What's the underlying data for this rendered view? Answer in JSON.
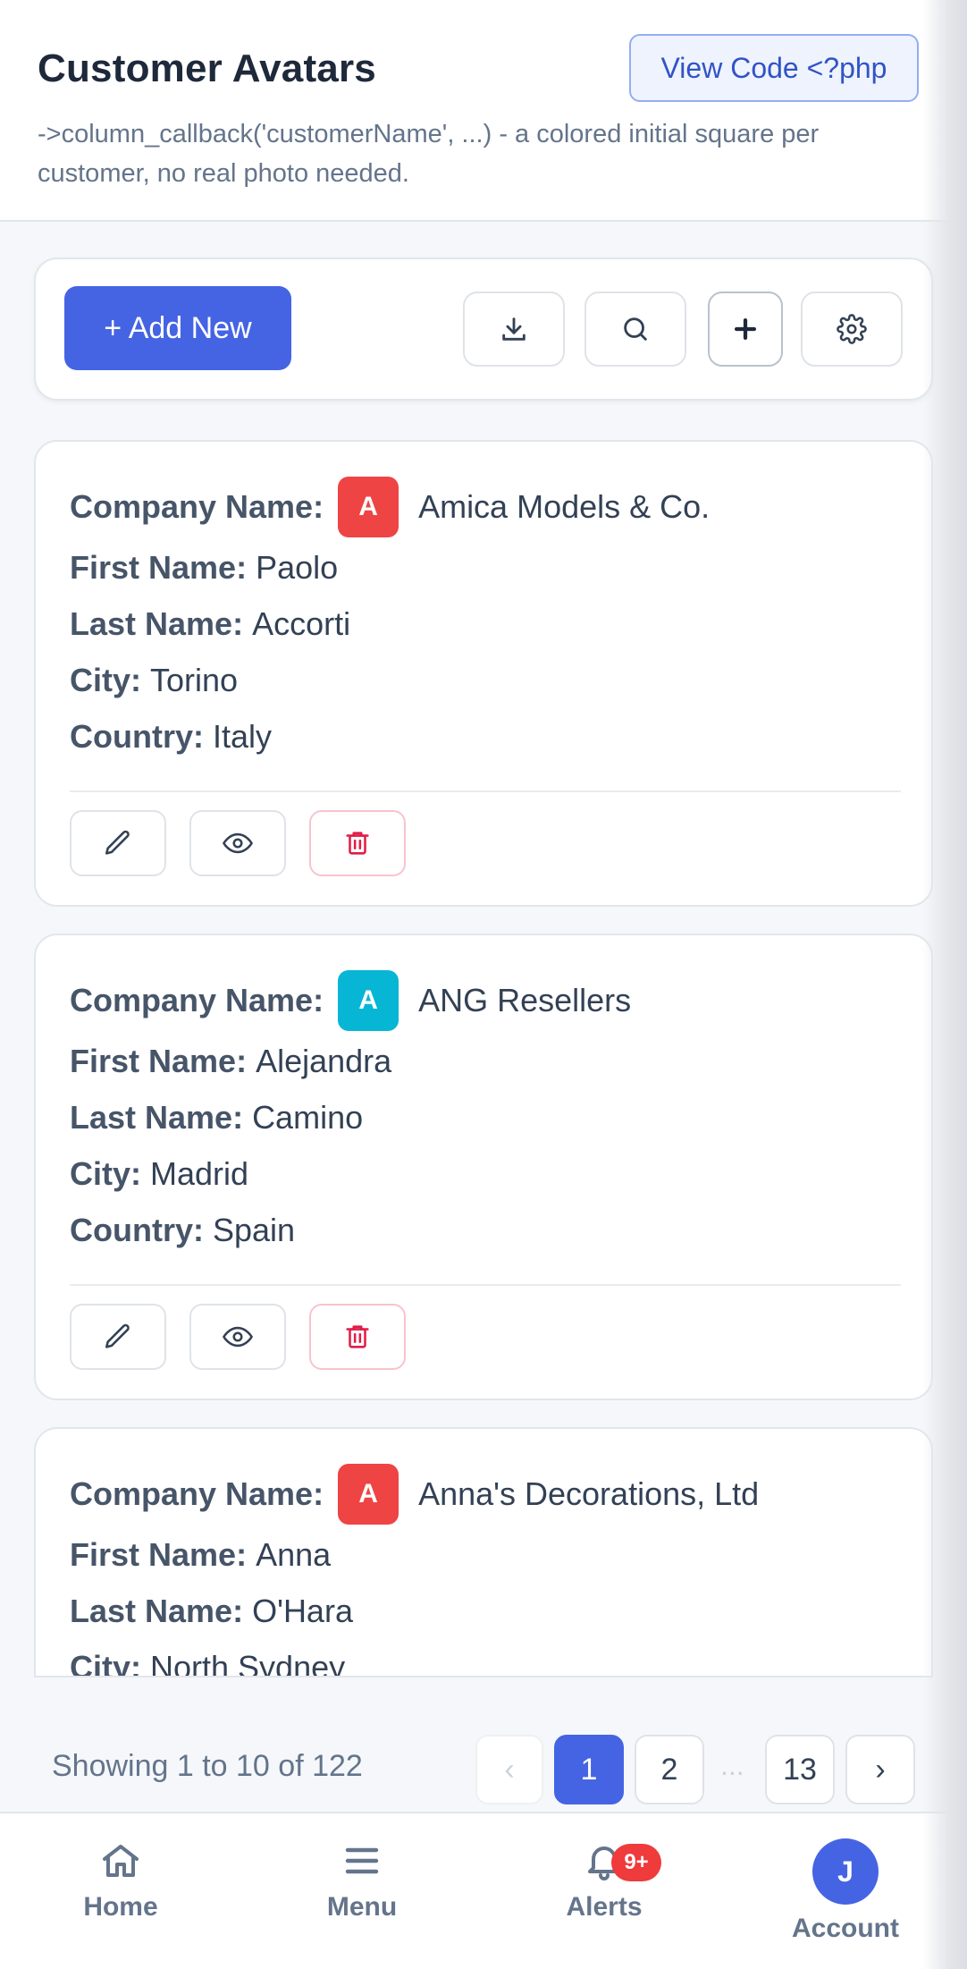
{
  "header": {
    "title": "Customer Avatars",
    "view_code_label": "View Code <?php",
    "subtitle": "->column_callback('customerName', ...) - a colored initial square per customer, no real photo needed."
  },
  "toolbar": {
    "add_new_label": "+ Add New",
    "icons": [
      "download-icon",
      "search-icon",
      "plus-icon",
      "gear-icon"
    ]
  },
  "labels": {
    "company": "Company Name:",
    "first": "First Name:",
    "last": "Last Name:",
    "city": "City:",
    "country": "Country:"
  },
  "customers": [
    {
      "initial": "A",
      "avatar_color": "#ef4444",
      "company": "Amica Models & Co.",
      "first": "Paolo",
      "last": "Accorti",
      "city": "Torino",
      "country": "Italy"
    },
    {
      "initial": "A",
      "avatar_color": "#06b6d4",
      "company": "ANG Resellers",
      "first": "Alejandra",
      "last": "Camino",
      "city": "Madrid",
      "country": "Spain"
    },
    {
      "initial": "A",
      "avatar_color": "#ef4444",
      "company": "Anna's Decorations, Ltd",
      "first": "Anna",
      "last": "O'Hara",
      "city": "North Sydney",
      "country": ""
    }
  ],
  "card_actions": [
    "pencil-icon",
    "eye-icon",
    "trash-icon"
  ],
  "pagination": {
    "showing": "Showing 1 to 10 of 122",
    "prev": "‹",
    "pages": [
      "1",
      "2"
    ],
    "ellipsis": "...",
    "last": "13",
    "next": "›"
  },
  "bottom_nav": {
    "home": "Home",
    "menu": "Menu",
    "alerts": "Alerts",
    "alerts_badge": "9+",
    "account": "Account",
    "account_initial": "J"
  },
  "colors": {
    "accent": "#4564e3",
    "danger": "#e11d48",
    "badge": "#ef3b3b"
  }
}
